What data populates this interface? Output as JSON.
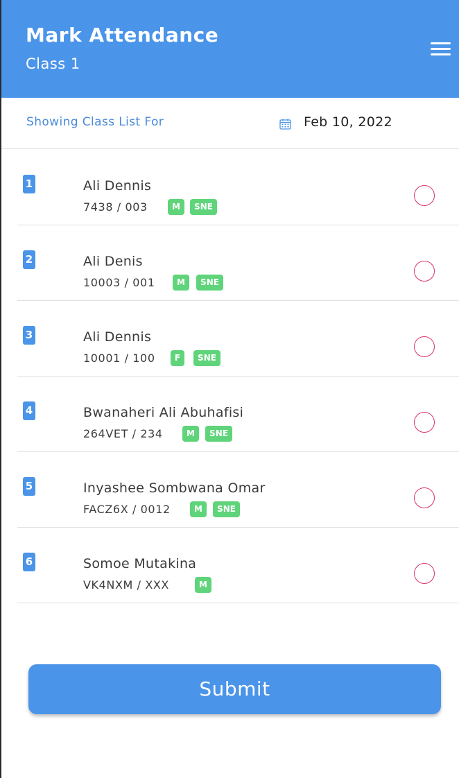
{
  "header": {
    "title": "Mark Attendance",
    "subtitle": "Class 1",
    "menu_icon": "hamburger-menu-icon"
  },
  "datebar": {
    "label": "Showing Class List For",
    "calendar_icon": "calendar-icon",
    "date": "Feb 10, 2022"
  },
  "students": [
    {
      "index": "1",
      "name": "Ali Dennis",
      "code": "7438 / 003",
      "badges": [
        "M",
        "SNE"
      ]
    },
    {
      "index": "2",
      "name": "Ali Denis",
      "code": "10003 / 001",
      "badges": [
        "M",
        "SNE"
      ]
    },
    {
      "index": "3",
      "name": "Ali Dennis",
      "code": "10001 / 100",
      "badges": [
        "F",
        "SNE"
      ]
    },
    {
      "index": "4",
      "name": "Bwanaheri Ali Abuhafisi",
      "code": "264VET / 234",
      "badges": [
        "M",
        "SNE"
      ]
    },
    {
      "index": "5",
      "name": "Inyashee Sombwana Omar",
      "code": "FACZ6X / 0012",
      "badges": [
        "M",
        "SNE"
      ]
    },
    {
      "index": "6",
      "name": "Somoe Mutakina",
      "code": "VK4NXM / XXX",
      "badges": [
        "M"
      ]
    }
  ],
  "submit_label": "Submit",
  "colors": {
    "primary": "#4a94e9",
    "badge": "#5fd47a",
    "radio_border": "#d6336c",
    "label_blue": "#4a8ad8"
  }
}
